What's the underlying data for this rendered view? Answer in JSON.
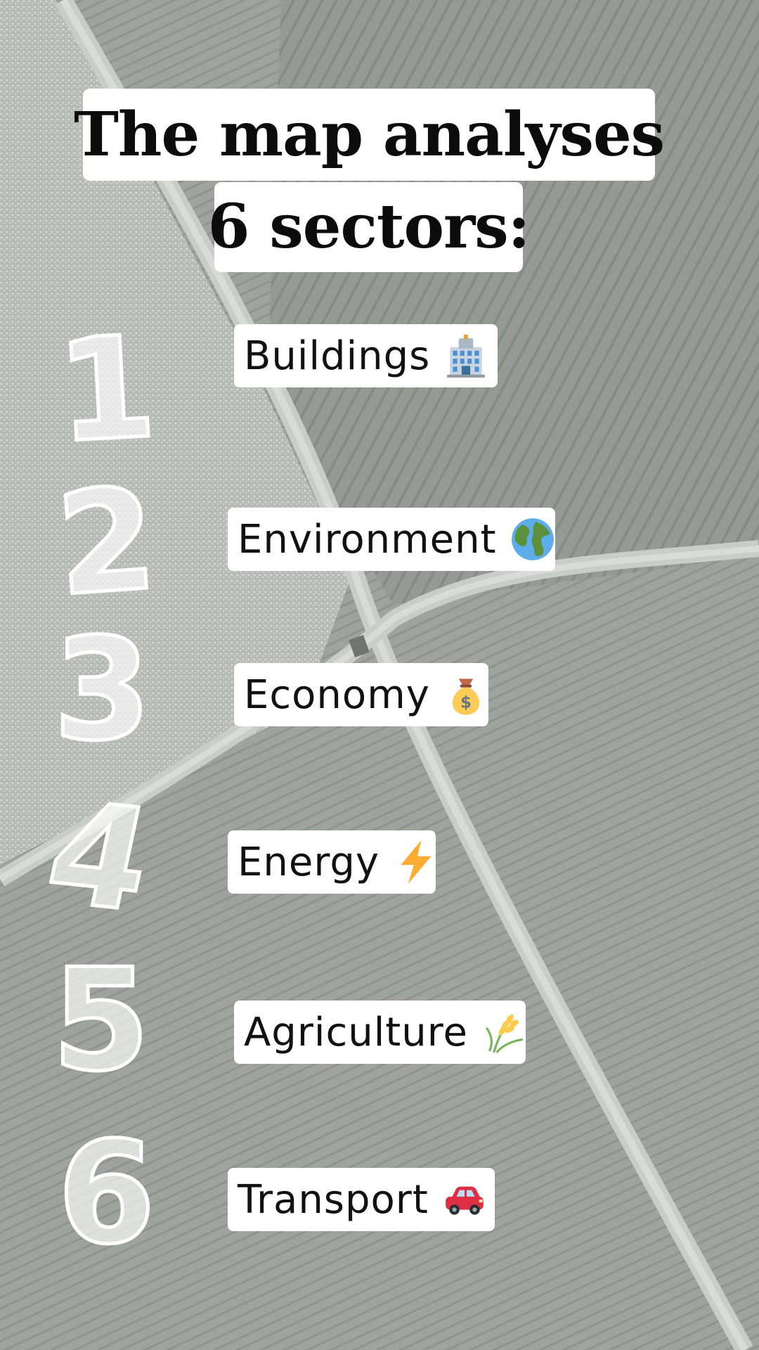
{
  "header": {
    "line1": "The map analyses",
    "line2": "6 sectors:"
  },
  "sectors": [
    {
      "number": "1",
      "label": "Buildings",
      "icon": "office-building-icon"
    },
    {
      "number": "2",
      "label": "Environment",
      "icon": "globe-icon"
    },
    {
      "number": "3",
      "label": "Economy",
      "icon": "money-bag-icon"
    },
    {
      "number": "4",
      "label": "Energy",
      "icon": "lightning-icon"
    },
    {
      "number": "5",
      "label": "Agriculture",
      "icon": "wheat-icon"
    },
    {
      "number": "6",
      "label": "Transport",
      "icon": "car-icon"
    }
  ],
  "colors": {
    "background": "#a3a8a3",
    "label_background": "#ffffff",
    "text": "#0c0c0c",
    "numbers": "#ffffff"
  }
}
